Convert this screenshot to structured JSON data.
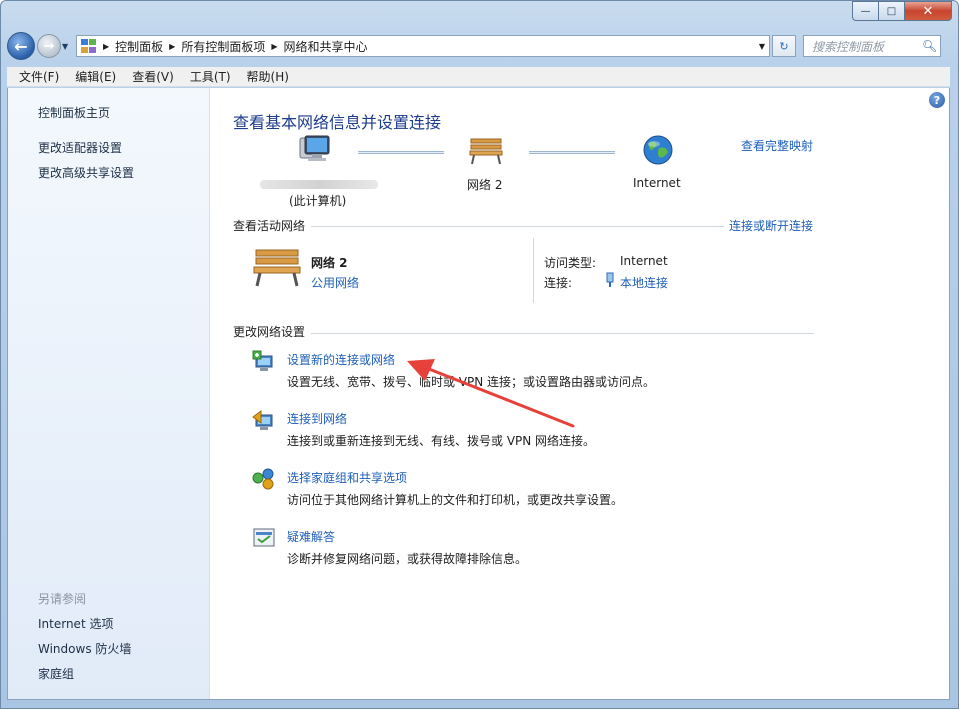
{
  "window": {
    "caption_min": "—",
    "caption_max": "□",
    "caption_close": "✕"
  },
  "address": {
    "crumbs": [
      "控制面板",
      "所有控制面板项",
      "网络和共享中心"
    ],
    "search_placeholder": "搜索控制面板"
  },
  "menu": [
    "文件(F)",
    "编辑(E)",
    "查看(V)",
    "工具(T)",
    "帮助(H)"
  ],
  "sidebar": {
    "links": [
      "控制面板主页",
      "更改适配器设置",
      "更改高级共享设置"
    ],
    "see_also_header": "另请参阅",
    "see_also": [
      "Internet 选项",
      "Windows 防火墙",
      "家庭组"
    ]
  },
  "main": {
    "title": "查看基本网络信息并设置连接",
    "view_full_map": "查看完整映射",
    "map": {
      "computer_label": "(此计算机)",
      "network_label": "网络  2",
      "internet_label": "Internet"
    },
    "active_networks_header": "查看活动网络",
    "connect_disconnect": "连接或断开连接",
    "network": {
      "name": "网络  2",
      "type": "公用网络",
      "access_type_label": "访问类型:",
      "access_type_value": "Internet",
      "connections_label": "连接:",
      "connections_value": "本地连接"
    },
    "change_settings_header": "更改网络设置",
    "tasks": [
      {
        "title": "设置新的连接或网络",
        "desc": "设置无线、宽带、拨号、临时或 VPN 连接；或设置路由器或访问点。"
      },
      {
        "title": "连接到网络",
        "desc": "连接到或重新连接到无线、有线、拨号或 VPN 网络连接。"
      },
      {
        "title": "选择家庭组和共享选项",
        "desc": "访问位于其他网络计算机上的文件和打印机，或更改共享设置。"
      },
      {
        "title": "疑难解答",
        "desc": "诊断并修复网络问题，或获得故障排除信息。"
      }
    ]
  },
  "colors": {
    "link": "#1f5fb8",
    "title": "#1e3c8c",
    "annotation_arrow": "#e8413a"
  }
}
